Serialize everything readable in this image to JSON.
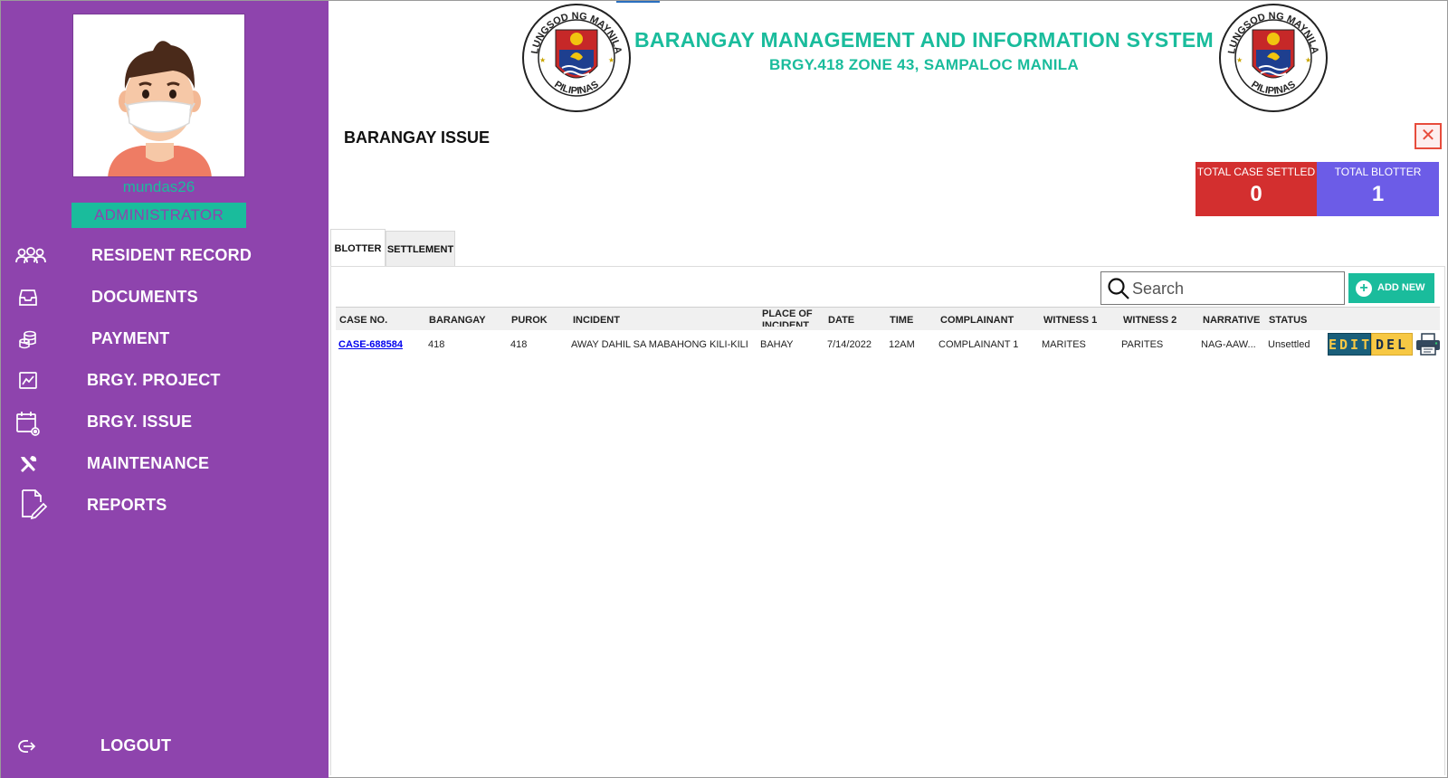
{
  "sidebar": {
    "username": "mundas26",
    "role": "ADMINISTRATOR",
    "nav": [
      {
        "label": "RESIDENT RECORD",
        "icon": "users-icon"
      },
      {
        "label": "DOCUMENTS",
        "icon": "inbox-tray-icon"
      },
      {
        "label": "PAYMENT",
        "icon": "coins-icon"
      },
      {
        "label": "BRGY. PROJECT",
        "icon": "chart-icon"
      },
      {
        "label": "BRGY. ISSUE",
        "icon": "calendar-gear-icon"
      },
      {
        "label": "MAINTENANCE",
        "icon": "tools-icon"
      },
      {
        "label": "REPORTS",
        "icon": "document-edit-icon"
      }
    ],
    "logout": "LOGOUT"
  },
  "header": {
    "title": "BARANGAY MANAGEMENT AND INFORMATION SYSTEM",
    "subtitle": "BRGY.418 ZONE 43, SAMPALOC MANILA",
    "seal_top_text": "LUNGSOD NG MAYNILA",
    "seal_bottom_text": "PILIPINAS"
  },
  "page": {
    "title": "BARANGAY ISSUE",
    "close_symbol": "✕"
  },
  "stats": {
    "settled": {
      "label": "TOTAL CASE SETTLED",
      "value": "0",
      "color": "#d32f2f"
    },
    "blotter": {
      "label": "TOTAL BLOTTER",
      "value": "1",
      "color": "#6c5ce7"
    }
  },
  "tabs": [
    "BLOTTER",
    "SETTLEMENT"
  ],
  "toolbar": {
    "search_placeholder": "Search",
    "add_label": "ADD NEW"
  },
  "table": {
    "headers": [
      "CASE NO.",
      "BARANGAY",
      "PUROK",
      "INCIDENT",
      "PLACE OF INCIDENT",
      "DATE",
      "TIME",
      "COMPLAINANT",
      "WITNESS 1",
      "WITNESS 2",
      "NARRATIVE",
      "STATUS"
    ],
    "rows": [
      {
        "case_no": "CASE-688584",
        "barangay": "418",
        "purok": "418",
        "incident": "AWAY DAHIL SA MABAHONG KILI-KILI",
        "place": "BAHAY",
        "date": "7/14/2022",
        "time": "12AM",
        "complainant": "COMPLAINANT 1",
        "witness1": "MARITES",
        "witness2": "PARITES",
        "narrative": "NAG-AAW...",
        "status": "Unsettled",
        "edit_label": "EDIT",
        "del_label": "DEL"
      }
    ]
  },
  "colors": {
    "sidebar": "#8e44ad",
    "accent": "#1abc9c"
  }
}
